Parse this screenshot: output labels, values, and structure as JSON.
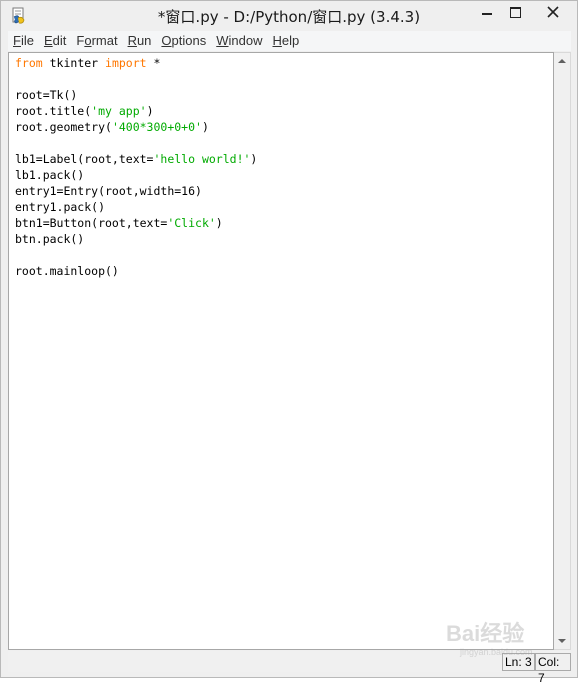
{
  "window": {
    "title": "*窗口.py - D:/Python/窗口.py (3.4.3)"
  },
  "menu": [
    {
      "label_underline": "F",
      "label_rest": "ile"
    },
    {
      "label_underline": "E",
      "label_rest": "dit"
    },
    {
      "label_pre": "F",
      "label_underline": "o",
      "label_rest": "rmat"
    },
    {
      "label_underline": "R",
      "label_rest": "un"
    },
    {
      "label_underline": "O",
      "label_rest": "ptions"
    },
    {
      "label_underline": "W",
      "label_rest": "indow"
    },
    {
      "label_underline": "H",
      "label_rest": "elp"
    }
  ],
  "code": {
    "lines": [
      [
        {
          "t": "from",
          "c": "kw"
        },
        {
          "t": " tkinter "
        },
        {
          "t": "import",
          "c": "kw"
        },
        {
          "t": " *"
        }
      ],
      [],
      [
        {
          "t": "root=Tk()"
        }
      ],
      [
        {
          "t": "root.title("
        },
        {
          "t": "'my app'",
          "c": "str"
        },
        {
          "t": ")"
        }
      ],
      [
        {
          "t": "root.geometry("
        },
        {
          "t": "'400*300+0+0'",
          "c": "str"
        },
        {
          "t": ")"
        }
      ],
      [],
      [
        {
          "t": "lb1=Label(root,text="
        },
        {
          "t": "'hello world!'",
          "c": "str"
        },
        {
          "t": ")"
        }
      ],
      [
        {
          "t": "lb1.pack()"
        }
      ],
      [
        {
          "t": "entry1=Entry(root,width=16)"
        }
      ],
      [
        {
          "t": "entry1.pack()"
        }
      ],
      [
        {
          "t": "btn1=Button(root,text="
        },
        {
          "t": "'Click'",
          "c": "str"
        },
        {
          "t": ")"
        }
      ],
      [
        {
          "t": "btn.pack()"
        }
      ],
      [],
      [
        {
          "t": "root.mainloop()"
        }
      ]
    ]
  },
  "status": {
    "line": "Ln: 3",
    "col": "Col: 7"
  },
  "watermark": {
    "text": "Bai经验",
    "subtext": "jingyan.baidu.com"
  },
  "colors": {
    "keyword": "#ff7700",
    "string": "#00aa00"
  },
  "icons": {
    "app": "python-idle-icon",
    "minimize": "minimize-icon",
    "maximize": "maximize-icon",
    "close": "close-icon"
  }
}
